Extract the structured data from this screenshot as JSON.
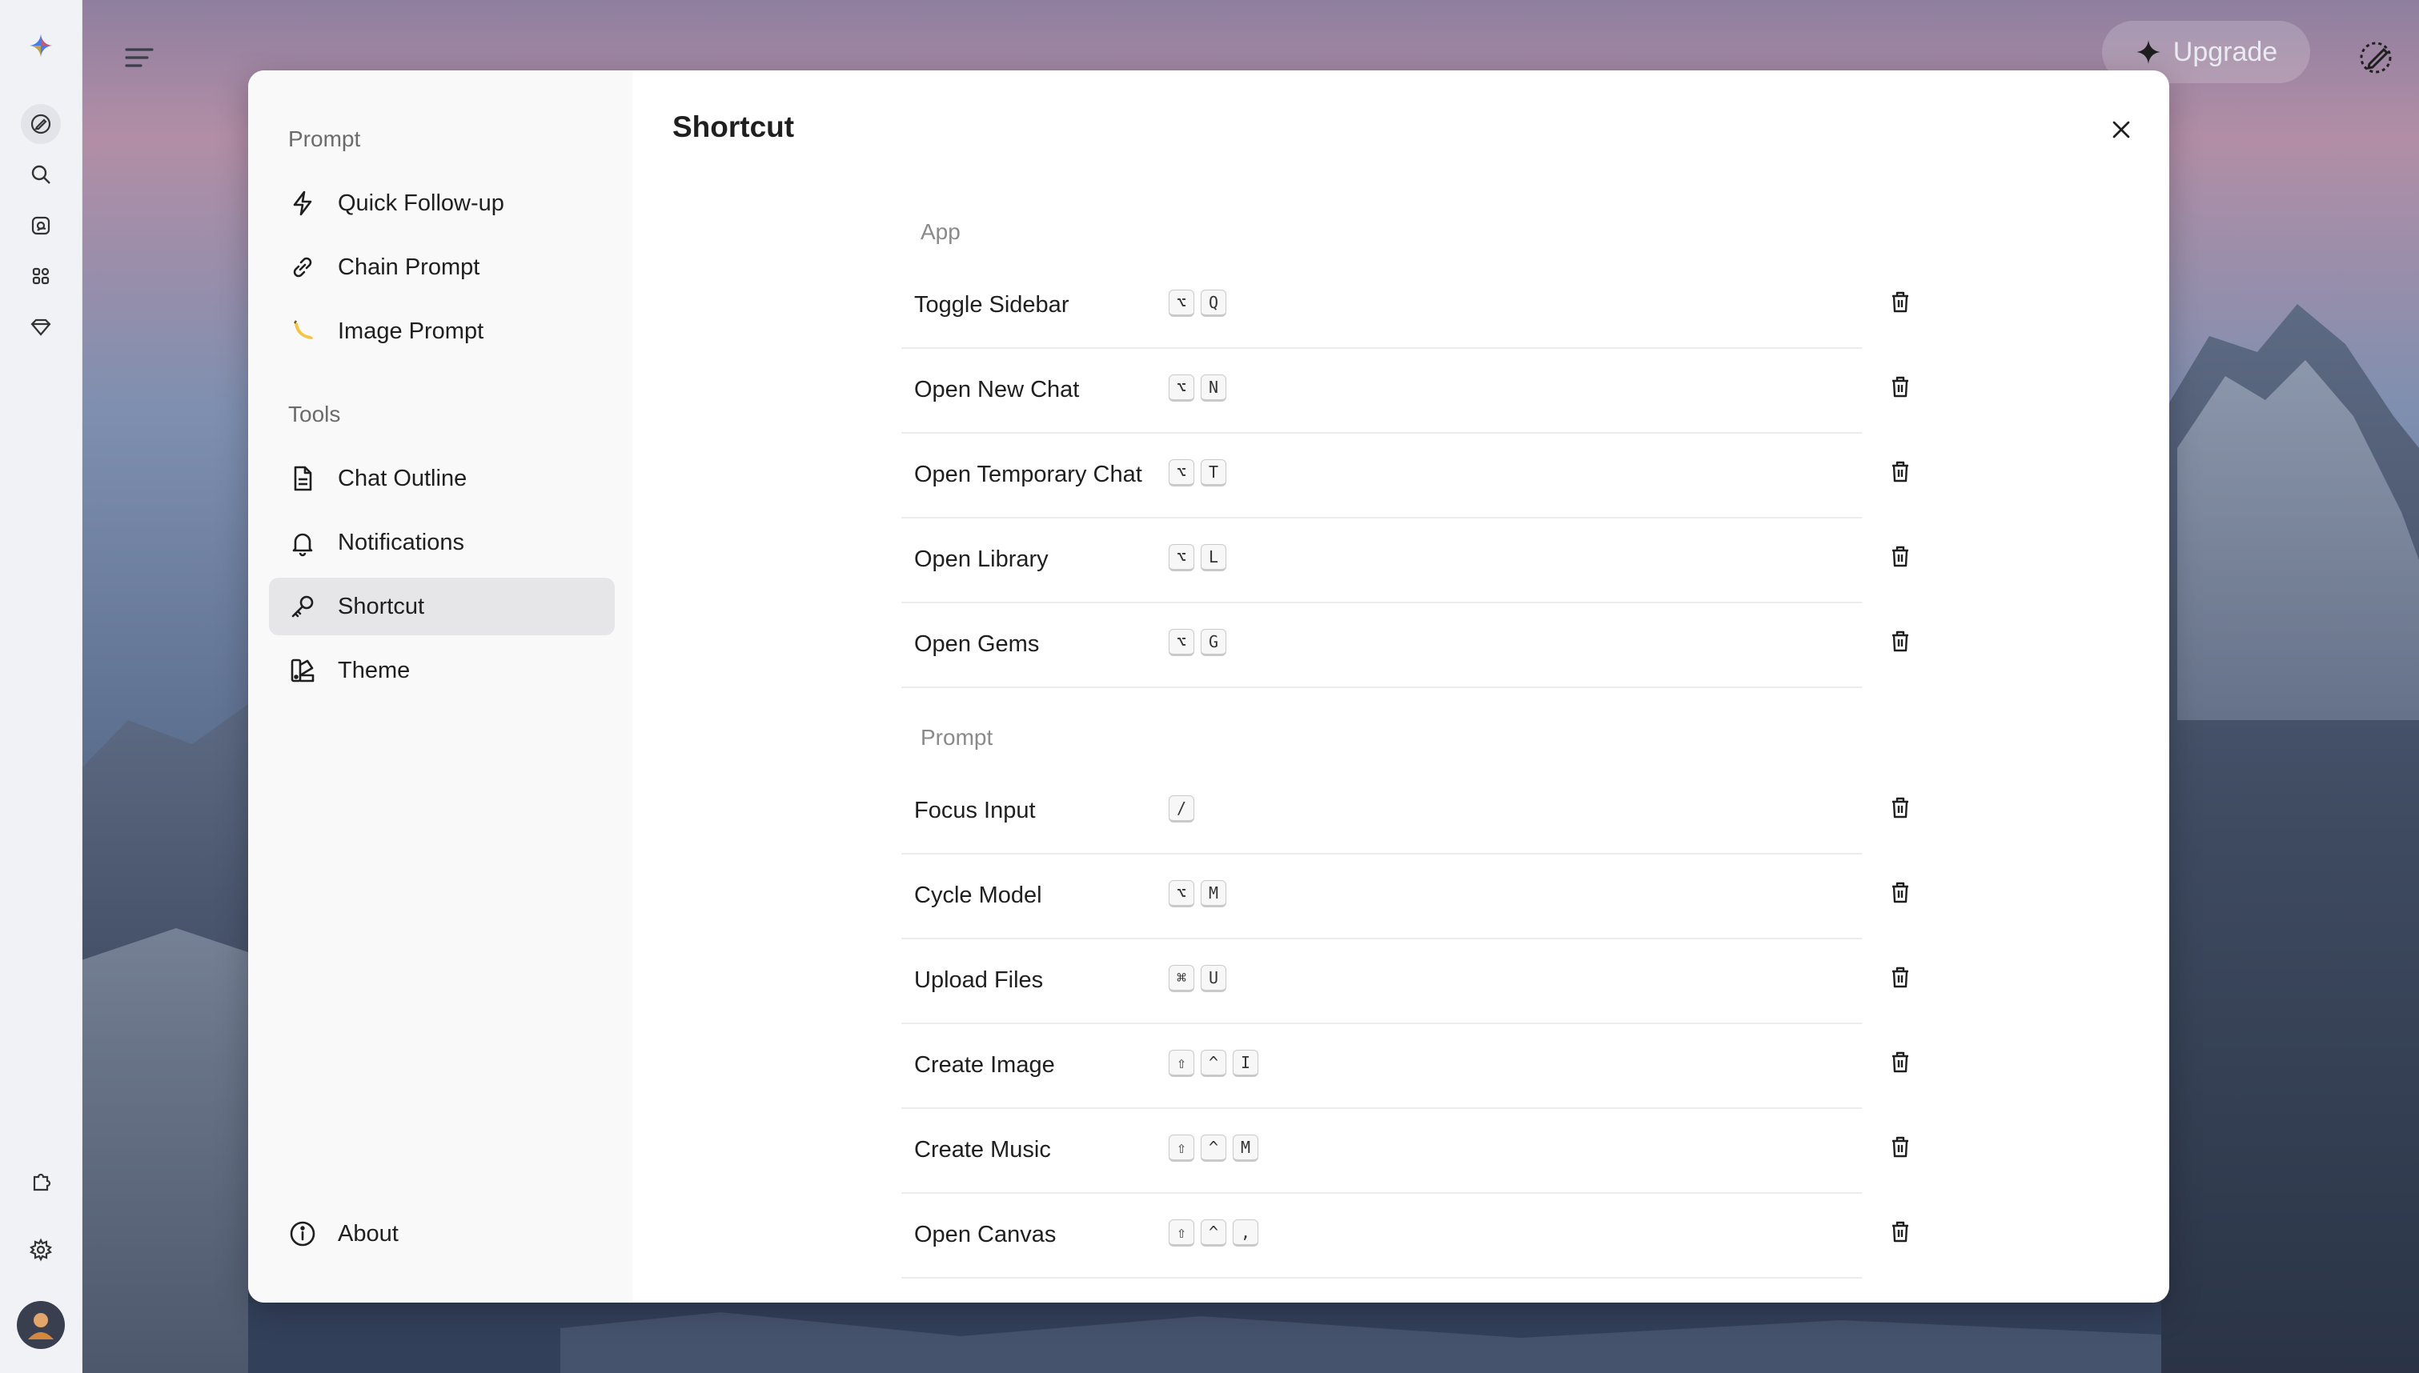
{
  "topbar": {
    "upgrade_label": "Upgrade"
  },
  "modal": {
    "title": "Shortcut",
    "sidebar": {
      "sections": [
        {
          "title": "Prompt",
          "items": [
            {
              "label": "Quick Follow-up",
              "icon": "lightning-icon"
            },
            {
              "label": "Chain Prompt",
              "icon": "link-icon"
            },
            {
              "label": "Image Prompt",
              "icon": "banana-icon"
            }
          ]
        },
        {
          "title": "Tools",
          "items": [
            {
              "label": "Chat Outline",
              "icon": "document-icon"
            },
            {
              "label": "Notifications",
              "icon": "bell-icon"
            },
            {
              "label": "Shortcut",
              "icon": "key-icon",
              "active": true
            },
            {
              "label": "Theme",
              "icon": "palette-icon"
            }
          ]
        }
      ],
      "about_label": "About"
    },
    "groups": [
      {
        "title": "App",
        "rows": [
          {
            "label": "Toggle Sidebar",
            "keys": [
              "⌥",
              "Q"
            ]
          },
          {
            "label": "Open New Chat",
            "keys": [
              "⌥",
              "N"
            ]
          },
          {
            "label": "Open Temporary Chat",
            "keys": [
              "⌥",
              "T"
            ]
          },
          {
            "label": "Open Library",
            "keys": [
              "⌥",
              "L"
            ]
          },
          {
            "label": "Open Gems",
            "keys": [
              "⌥",
              "G"
            ]
          }
        ]
      },
      {
        "title": "Prompt",
        "rows": [
          {
            "label": "Focus Input",
            "keys": [
              "/"
            ]
          },
          {
            "label": "Cycle Model",
            "keys": [
              "⌥",
              "M"
            ]
          },
          {
            "label": "Upload Files",
            "keys": [
              "⌘",
              "U"
            ]
          },
          {
            "label": "Create Image",
            "keys": [
              "⇧",
              "^",
              "I"
            ]
          },
          {
            "label": "Create Music",
            "keys": [
              "⇧",
              "^",
              "M"
            ]
          },
          {
            "label": "Open Canvas",
            "keys": [
              "⇧",
              "^",
              ","
            ]
          }
        ]
      }
    ]
  }
}
